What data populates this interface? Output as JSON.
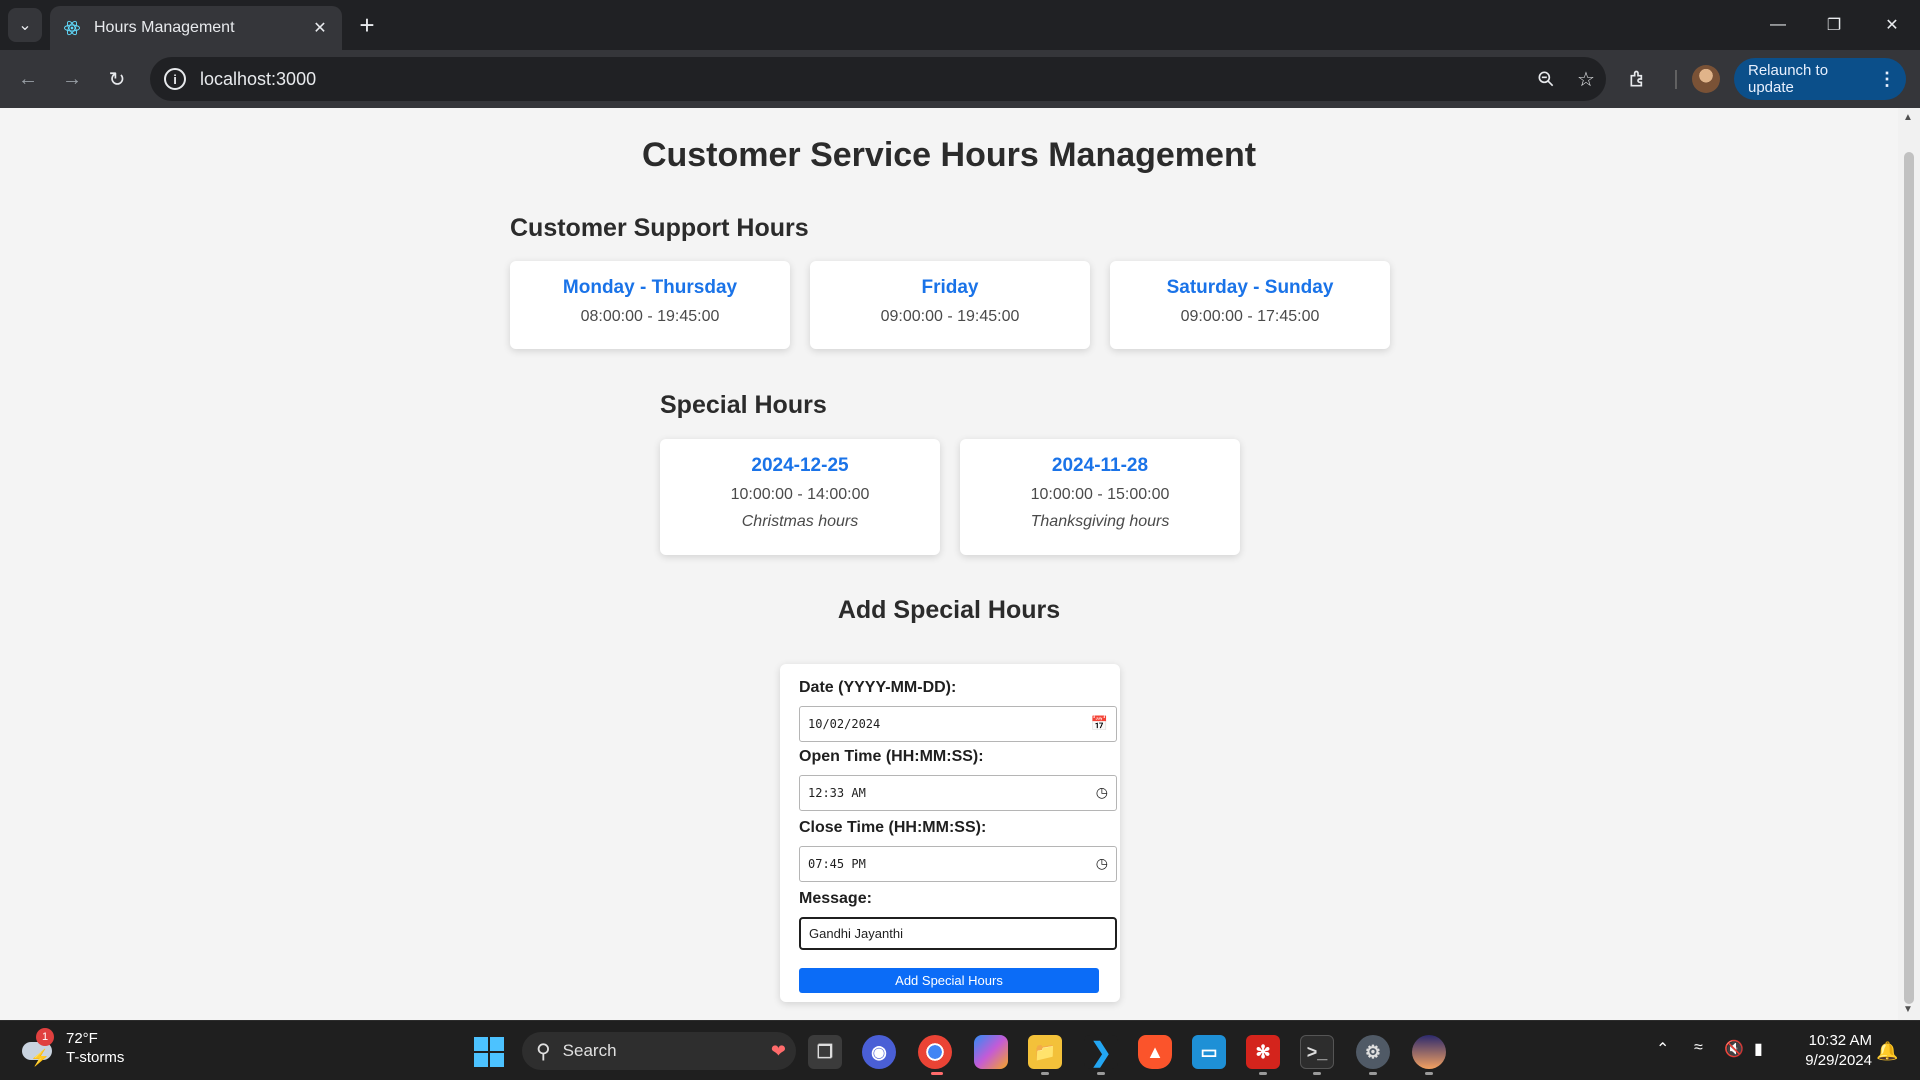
{
  "browser": {
    "tab_title": "Hours Management",
    "url": "localhost:3000",
    "relaunch_label": "Relaunch to update"
  },
  "page": {
    "title": "Customer Service Hours Management",
    "support_heading": "Customer Support Hours",
    "support_hours": [
      {
        "days": "Monday - Thursday",
        "time": "08:00:00 - 19:45:00"
      },
      {
        "days": "Friday",
        "time": "09:00:00 - 19:45:00"
      },
      {
        "days": "Saturday - Sunday",
        "time": "09:00:00 - 17:45:00"
      }
    ],
    "special_heading": "Special Hours",
    "special_hours": [
      {
        "date": "2024-12-25",
        "time": "10:00:00 - 14:00:00",
        "message": "Christmas hours"
      },
      {
        "date": "2024-11-28",
        "time": "10:00:00 - 15:00:00",
        "message": "Thanksgiving hours"
      }
    ],
    "add_heading": "Add Special Hours",
    "form": {
      "date_label": "Date (YYYY-MM-DD):",
      "date_value": "10/02/2024",
      "open_label": "Open Time (HH:MM:SS):",
      "open_value": "12:33 AM",
      "close_label": "Close Time (HH:MM:SS):",
      "close_value": "07:45 PM",
      "message_label": "Message:",
      "message_value": "Gandhi Jayanthi",
      "submit_label": "Add Special Hours"
    }
  },
  "taskbar": {
    "weather_temp": "72°F",
    "weather_desc": "T-storms",
    "weather_badge": "1",
    "search_label": "Search",
    "time": "10:32 AM",
    "date": "9/29/2024"
  },
  "colors": {
    "accent": "#1a73e8",
    "submit_button": "#0b6cf7",
    "page_bg": "#f4f4f4"
  }
}
